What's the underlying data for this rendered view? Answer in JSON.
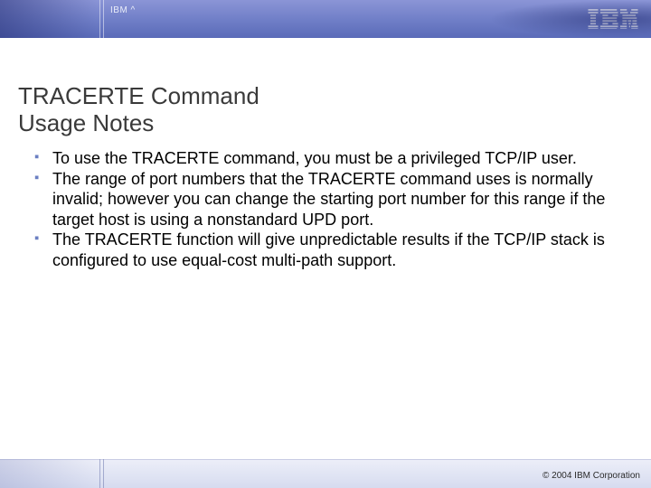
{
  "header": {
    "product": "IBM ^"
  },
  "title": {
    "line1": "TRACERTE Command",
    "line2": "Usage Notes"
  },
  "bullets": [
    "To use the TRACERTE command, you must be a privileged TCP/IP user.",
    "The range of port numbers that the TRACERTE command uses is normally invalid; however you can change the starting port number for this range if the target host is using a nonstandard UPD port.",
    "The TRACERTE function will give unpredictable results if the TCP/IP stack is configured to use equal-cost multi-path support."
  ],
  "footer": {
    "copyright": "© 2004 IBM Corporation"
  }
}
